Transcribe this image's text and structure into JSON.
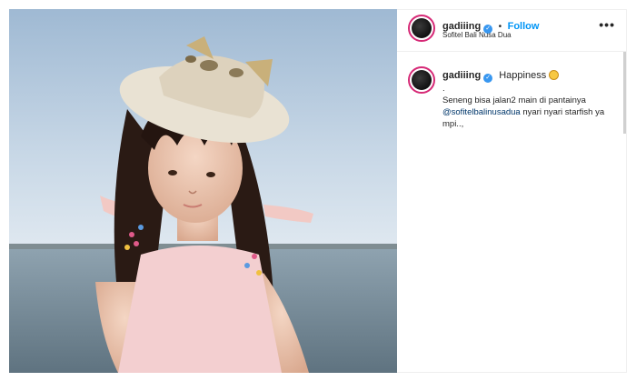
{
  "post": {
    "username": "gadiiing",
    "separator": "•",
    "follow_label": "Follow",
    "location": "Sofitel Bali Nusa Dua",
    "more_label": "•••",
    "verified_glyph": "✓"
  },
  "comment": {
    "username": "gadiiing",
    "caption_title": "Happiness",
    "dot_line": ".",
    "text_before": "Seneng bisa jalan2 main di pantainya",
    "mention": "@sofitelbalinusadua",
    "text_after": "nyari nyari starfish ya mpi..,",
    "emoji": "smiling-face-emoji"
  },
  "colors": {
    "follow": "#0095f6",
    "verified": "#3897f0",
    "mention": "#00376b",
    "avatar_ring": "#d62976"
  },
  "icons": [
    "verified-badge-icon",
    "more-options-icon",
    "smiling-face-emoji"
  ]
}
